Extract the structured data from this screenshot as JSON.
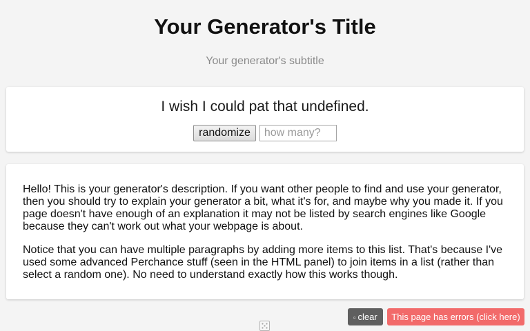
{
  "header": {
    "title": "Your Generator's Title",
    "subtitle": "Your generator's subtitle"
  },
  "output": {
    "text": "I wish I could pat that undefined.",
    "randomize_label": "randomize",
    "count_placeholder": "how many?",
    "count_value": ""
  },
  "description": {
    "paragraphs": [
      "Hello! This is your generator's description. If you want other people to find and use your generator, then you should try to explain your generator a bit, what it's for, and maybe why you made it. If you page doesn't have enough of an explanation it may not be listed by search engines like Google because they can't work out what your webpage is about.",
      "Notice that you can have multiple paragraphs by adding more items to this list. That's because I've used some advanced Perchance stuff (seen in the HTML panel) to join items in a list (rather than select a random one). No need to understand exactly how this works though."
    ]
  },
  "footer": {
    "clear_icon": "broom-icon",
    "clear_label": "clear",
    "errors_label": "This page has errors (click here)",
    "dice_icon": "dice-icon"
  },
  "colors": {
    "background": "#f4f4f4",
    "card": "#ffffff",
    "subtitle": "#8a8a8a",
    "clear_button": "#5f5f5f",
    "errors_button": "#f26a6a"
  }
}
